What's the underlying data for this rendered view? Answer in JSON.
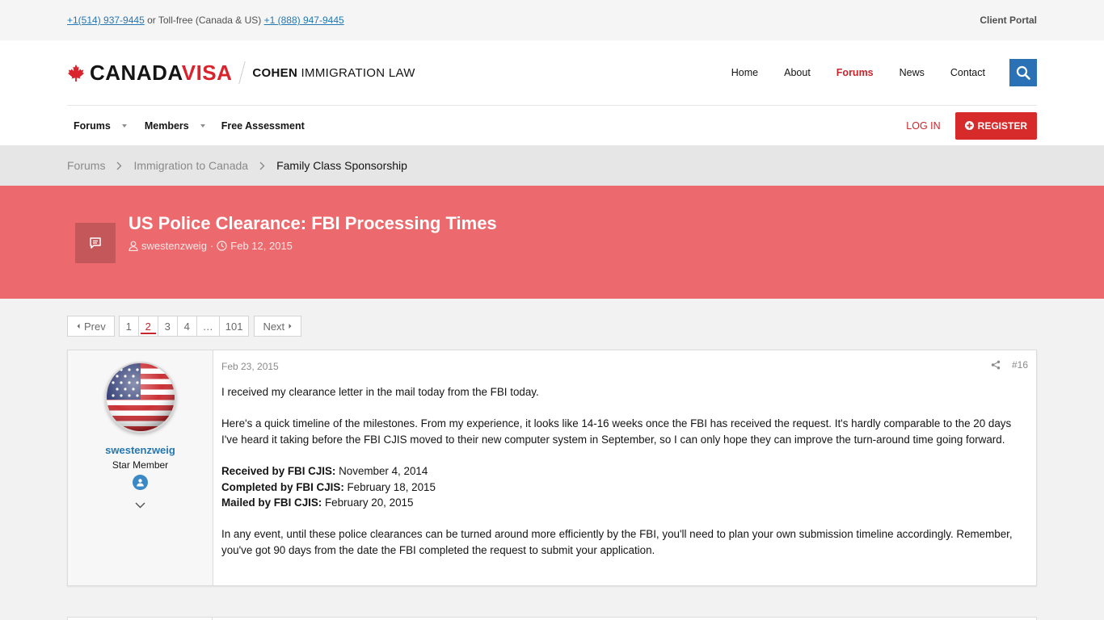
{
  "topbar": {
    "phone_local": "+1(514) 937-9445",
    "separator_text": " or Toll-free (Canada & US) ",
    "phone_tollfree": "+1 (888) 947-9445",
    "client_portal": "Client Portal"
  },
  "logo": {
    "canada": "CANADA",
    "visa": "VISA",
    "cohen_bold": "COHEN",
    "cohen_rest": " IMMIGRATION LAW"
  },
  "nav": {
    "items": [
      "Home",
      "About",
      "Forums",
      "News",
      "Contact"
    ],
    "active": "Forums"
  },
  "subnav": {
    "forums": "Forums",
    "members": "Members",
    "free_assessment": "Free Assessment",
    "login": "LOG IN",
    "register": "REGISTER"
  },
  "breadcrumb": [
    "Forums",
    "Immigration to Canada",
    "Family Class Sponsorship"
  ],
  "thread": {
    "title": "US Police Clearance: FBI Processing Times",
    "author": "swestenzweig",
    "date": "Feb 12, 2015"
  },
  "pagination": {
    "prev": "Prev",
    "next": "Next",
    "pages": [
      "1",
      "2",
      "3",
      "4",
      "…",
      "101"
    ],
    "current": "2"
  },
  "post": {
    "date": "Feb 23, 2015",
    "number": "#16",
    "user": {
      "name": "swestenzweig",
      "title": "Star Member"
    },
    "p1": "I received my clearance letter in the mail today from the FBI today.",
    "p2": "Here's a quick timeline of the milestones. From my experience, it looks like 14-16 weeks once the FBI has received the request. It's hardly comparable to the 20 days I've heard it taking before the FBI CJIS moved to their new computer system in September, so I can only hope they can improve the turn-around time going forward.",
    "milestones": [
      {
        "label": "Received by FBI CJIS:",
        "value": " November 4, 2014"
      },
      {
        "label": "Completed by FBI CJIS:",
        "value": " February 18, 2015"
      },
      {
        "label": "Mailed by FBI CJIS:",
        "value": " February 20, 2015"
      }
    ],
    "p3": "In any event, until these police clearances can be turned around more efficiently by the FBI, you'll need to plan your own submission timeline accordingly. Remember, you've got 90 days from the date the FBI completed the request to submit your application."
  },
  "colors": {
    "brand_red": "#d72b2b",
    "band_red": "#ec6a6d",
    "link_blue": "#2577b1",
    "search_blue": "#2a72b5"
  }
}
